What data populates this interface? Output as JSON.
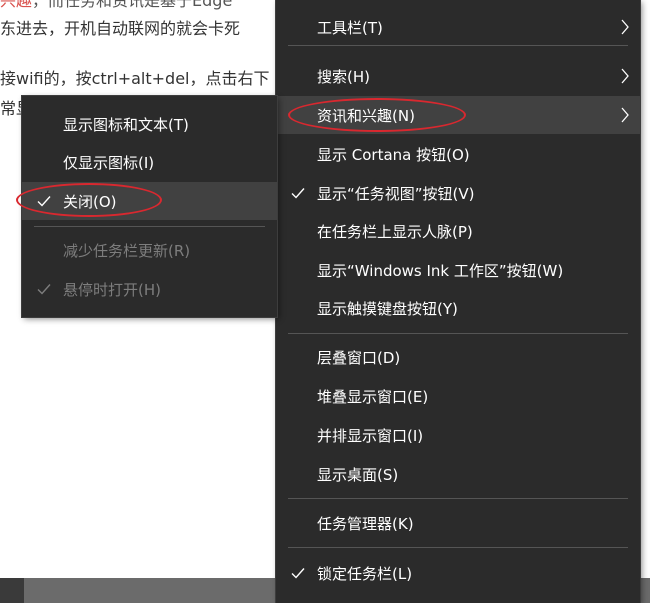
{
  "article": {
    "line1_red": "兴趣",
    "line1_rest": "，而任务和资讯是基于Edge",
    "line2": "东进去，开机自动联网的就会卡死",
    "line3": "接wifi的，按ctrl+alt+del，点击右下",
    "line4": "常显"
  },
  "main_menu": {
    "items": [
      {
        "label": "工具栏(T)",
        "submenu": true
      },
      {
        "label": "搜索(H)",
        "submenu": true
      },
      {
        "label": "资讯和兴趣(N)",
        "submenu": true,
        "highlighted": true
      },
      {
        "label": "显示 Cortana 按钮(O)"
      },
      {
        "label": "显示“任务视图”按钮(V)",
        "checked": true
      },
      {
        "label": "在任务栏上显示人脉(P)"
      },
      {
        "label": "显示“Windows Ink 工作区”按钮(W)"
      },
      {
        "label": "显示触摸键盘按钮(Y)"
      },
      {
        "label": "层叠窗口(D)"
      },
      {
        "label": "堆叠显示窗口(E)"
      },
      {
        "label": "并排显示窗口(I)"
      },
      {
        "label": "显示桌面(S)"
      },
      {
        "label": "任务管理器(K)"
      },
      {
        "label": "锁定任务栏(L)",
        "checked": true
      }
    ]
  },
  "sub_menu": {
    "items": [
      {
        "label": "显示图标和文本(T)"
      },
      {
        "label": "仅显示图标(I)"
      },
      {
        "label": "关闭(O)",
        "checked": true,
        "highlighted": true
      },
      {
        "label": "减少任务栏更新(R)",
        "disabled": true
      },
      {
        "label": "悬停时打开(H)",
        "checked": true,
        "disabled": true
      }
    ]
  },
  "colors": {
    "menu_bg": "#2b2b2b",
    "hover_bg": "#414141",
    "annotation": "#d9282f",
    "disabled_text": "#7d7d7d"
  }
}
